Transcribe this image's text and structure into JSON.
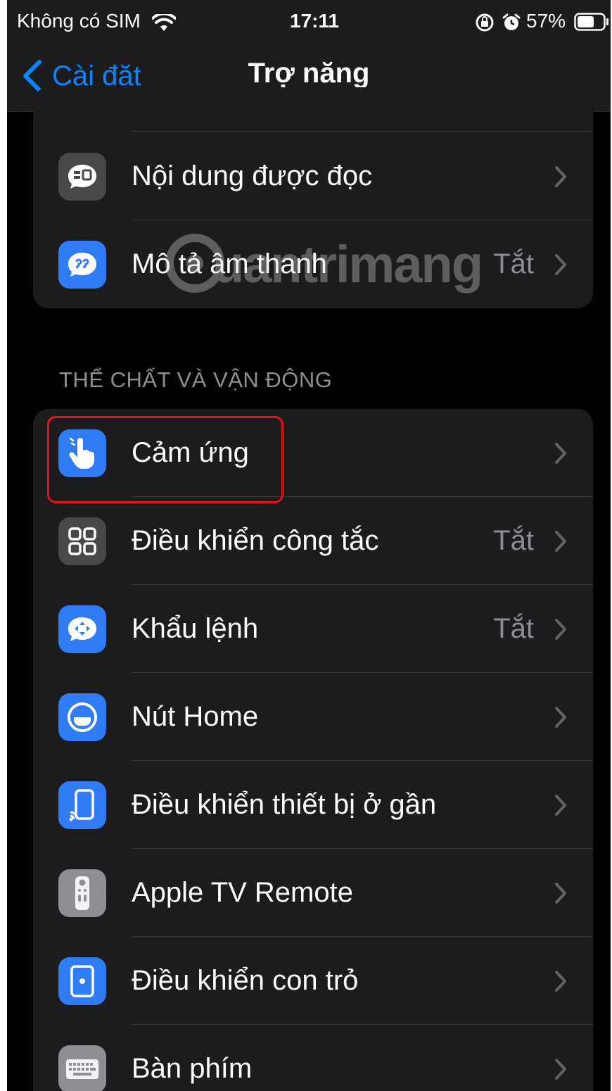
{
  "status_bar": {
    "carrier": "Không có SIM",
    "time": "17:11",
    "battery": "57%",
    "icons": [
      "wifi-icon",
      "orientation-lock-icon",
      "alarm-icon",
      "battery-icon"
    ]
  },
  "nav": {
    "back_label": "Cài đặt",
    "title": "Trợ năng"
  },
  "group_top": {
    "items": [
      {
        "label": "Nội dung được đọc",
        "value": "",
        "icon": "spoken-content-icon",
        "icon_color": "#48484a"
      },
      {
        "label": "Mô tả âm thanh",
        "value": "Tắt",
        "icon": "audio-descriptions-icon",
        "icon_color": "#2f7cf6"
      }
    ]
  },
  "section_header": "THỂ CHẤT VÀ VẬN ĐỘNG",
  "group_physical": {
    "items": [
      {
        "label": "Cảm ứng",
        "value": "",
        "icon": "touch-hand-icon",
        "icon_color": "#2f7cf6"
      },
      {
        "label": "Điều khiển công tắc",
        "value": "Tắt",
        "icon": "switch-control-icon",
        "icon_color": "#48484a"
      },
      {
        "label": "Khẩu lệnh",
        "value": "Tắt",
        "icon": "voice-control-icon",
        "icon_color": "#2f7cf6"
      },
      {
        "label": "Nút Home",
        "value": "",
        "icon": "home-button-icon",
        "icon_color": "#2f7cf6"
      },
      {
        "label": "Điều khiển thiết bị ở gần",
        "value": "",
        "icon": "nearby-devices-icon",
        "icon_color": "#2f7cf6"
      },
      {
        "label": "Apple TV Remote",
        "value": "",
        "icon": "tv-remote-icon",
        "icon_color": "#8e8e93"
      },
      {
        "label": "Điều khiển con trỏ",
        "value": "",
        "icon": "pointer-control-icon",
        "icon_color": "#2f7cf6"
      },
      {
        "label": "Bàn phím",
        "value": "",
        "icon": "keyboard-icon",
        "icon_color": "#8e8e93"
      }
    ]
  },
  "watermark": "uantrimang",
  "colors": {
    "accent": "#0a84ff",
    "highlight": "#e0141e",
    "background": "#000000",
    "cell": "#1c1c1e"
  }
}
